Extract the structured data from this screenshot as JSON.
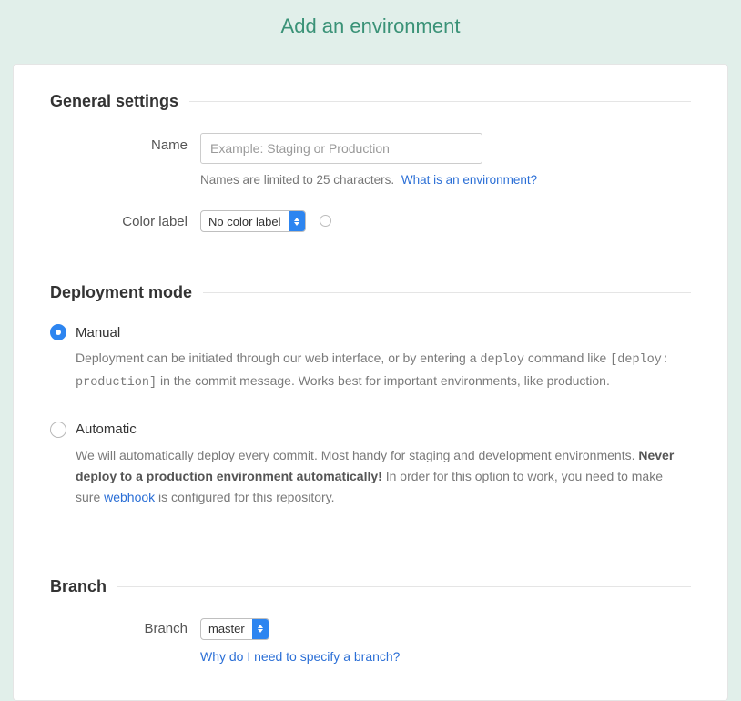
{
  "page_title": "Add an environment",
  "general": {
    "heading": "General settings",
    "name_label": "Name",
    "name_placeholder": "Example: Staging or Production",
    "name_help": "Names are limited to 25 characters.",
    "name_help_link": "What is an environment?",
    "color_label": "Color label",
    "color_select": "No color label"
  },
  "deployment": {
    "heading": "Deployment mode",
    "manual": {
      "label": "Manual",
      "desc_a": "Deployment can be initiated through our web interface, or by entering a ",
      "code_a": "deploy",
      "desc_b": " command like ",
      "code_b": "[deploy: production]",
      "desc_c": " in the commit message. Works best for important environments, like production."
    },
    "auto": {
      "label": "Automatic",
      "desc_a": "We will automatically deploy every commit. Most handy for staging and development environments. ",
      "bold": "Never deploy to a production environment automatically!",
      "desc_b": " In order for this option to work, you need to make sure ",
      "link": "webhook",
      "desc_c": " is configured for this repository."
    }
  },
  "branch": {
    "heading": "Branch",
    "label": "Branch",
    "select": "master",
    "help_link": "Why do I need to specify a branch?"
  }
}
